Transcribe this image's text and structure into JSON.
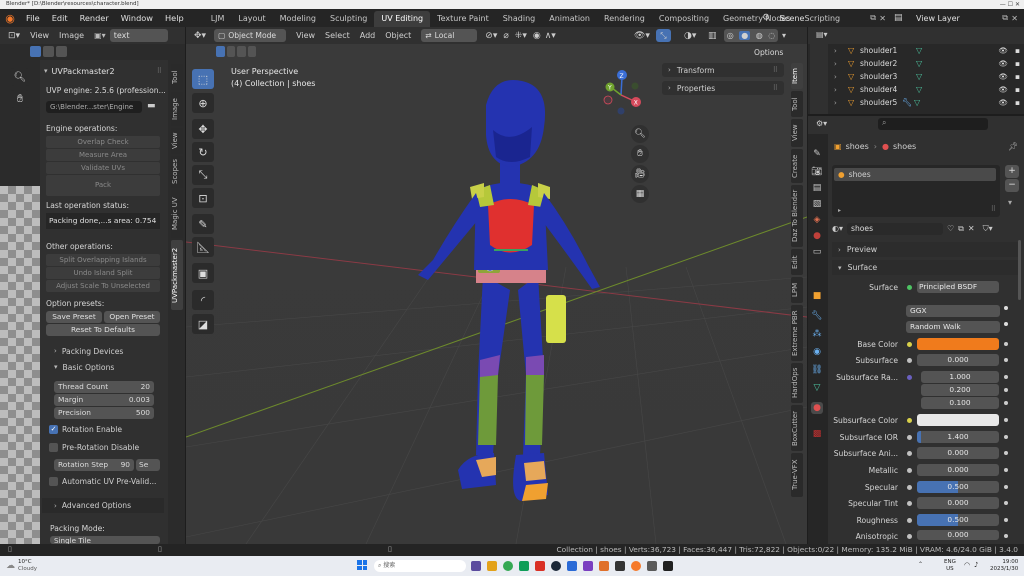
{
  "window": {
    "title": "Blender* [D:\\Blender\\resources\\character.blend]",
    "controls": "—  ☐  ✕"
  },
  "menubar": {
    "menus": [
      "File",
      "Edit",
      "Render",
      "Window",
      "Help"
    ],
    "workspaces": [
      "LJM",
      "Layout",
      "Modeling",
      "Sculpting",
      "UV Editing",
      "Texture Paint",
      "Shading",
      "Animation",
      "Rendering",
      "Compositing",
      "Geometry Nodes",
      "Scripting"
    ],
    "active_workspace": "UV Editing",
    "scene": "Scene",
    "view_layer": "View Layer"
  },
  "uv_editor": {
    "header": {
      "view": "View",
      "image": "Image",
      "image_name": "text"
    },
    "side_tabs": [
      "Tool",
      "Image",
      "View",
      "Scopes",
      "Magic UV",
      "UVPackmaster2"
    ],
    "uvp": {
      "title": "UVPackmaster2",
      "engine": "UVP engine: 2.5.6 (profession...",
      "path": "G:\\Blender...ster\\Engine",
      "engine_ops_label": "Engine operations:",
      "engine_ops": [
        "Overlap Check",
        "Measure Area",
        "Validate UVs",
        "Pack"
      ],
      "last_status_label": "Last operation status:",
      "last_status": "Packing done,...s area: 0.754",
      "other_ops_label": "Other operations:",
      "other_ops": [
        "Split Overlapping Islands",
        "Undo Island Split",
        "Adjust Scale To Unselected"
      ],
      "presets_label": "Option presets:",
      "save_preset": "Save Preset",
      "open_preset": "Open Preset",
      "reset_defaults": "Reset To Defaults",
      "packing_devices": "Packing Devices",
      "basic_options": "Basic Options",
      "thread_count_label": "Thread Count",
      "thread_count": "20",
      "margin_label": "Margin",
      "margin": "0.003",
      "precision_label": "Precision",
      "precision": "500",
      "rotation_enable": "Rotation Enable",
      "pre_rotation": "Pre-Rotation Disable",
      "rotation_step_label": "Rotation Step",
      "rotation_step": "90",
      "rotation_step_unit": "Se",
      "auto_uv": "Automatic UV Pre-Valid...",
      "advanced_options": "Advanced Options",
      "packing_mode_label": "Packing Mode:",
      "packing_mode": "Single Tile"
    }
  },
  "viewport": {
    "mode": "Object Mode",
    "menus": [
      "View",
      "Select",
      "Add",
      "Object"
    ],
    "transform_orientation": "Local",
    "options": "Options",
    "perspective": "User Perspective",
    "collection": "(4) Collection | shoes",
    "n_panel": {
      "transform": "Transform",
      "properties": "Properties"
    },
    "side_tabs": [
      "Item",
      "Tool",
      "View",
      "Create",
      "Daz To Blender",
      "Edit",
      "LPM",
      "Extreme PBR",
      "HardOps",
      "BoxCutter",
      "True-VFX"
    ],
    "gizmo": {
      "x": "X",
      "y": "Y",
      "z": "Z"
    }
  },
  "outliner": {
    "rows": [
      "shoulder1",
      "shoulder2",
      "shoulder3",
      "shoulder4",
      "shoulder5"
    ]
  },
  "properties": {
    "breadcrumb_obj": "shoes",
    "breadcrumb_mat": "shoes",
    "material_slot": "shoes",
    "material_name": "shoes",
    "preview": "Preview",
    "surface_section": "Surface",
    "surface_label": "Surface",
    "surface_value": "Principled BSDF",
    "distribution": "GGX",
    "subsurface_method": "Random Walk",
    "fields": [
      {
        "label": "Base Color",
        "type": "color",
        "color": "#f07b1c"
      },
      {
        "label": "Subsurface",
        "value": "0.000"
      },
      {
        "label": "Subsurface Ra...",
        "values": [
          "1.000",
          "0.200",
          "0.100"
        ]
      },
      {
        "label": "Subsurface Color",
        "type": "color",
        "color": "#e8e8e8"
      },
      {
        "label": "Subsurface IOR",
        "value": "1.400",
        "fill": 0.05
      },
      {
        "label": "Subsurface Ani...",
        "value": "0.000"
      },
      {
        "label": "Metallic",
        "value": "0.000"
      },
      {
        "label": "Specular",
        "value": "0.500",
        "fill": 0.5
      },
      {
        "label": "Specular Tint",
        "value": "0.000"
      },
      {
        "label": "Roughness",
        "value": "0.500",
        "fill": 0.5
      },
      {
        "label": "Anisotropic",
        "value": "0.000"
      }
    ]
  },
  "statusbar": {
    "text": "Collection | shoes | Verts:36,723 | Faces:36,447 | Tris:72,822 | Objects:0/22 | Memory: 135.2 MiB | VRAM: 4.6/24.0 GiB | 3.4.0"
  },
  "taskbar": {
    "weather_temp": "10°C",
    "weather_desc": "Cloudy",
    "search": "搜索",
    "lang": "ENG",
    "lang2": "US",
    "time": "19:00",
    "date": "2023/1/30"
  },
  "colors": {
    "accent": "#4772b3",
    "base_color": "#f07b1c",
    "bg": "#1d1d1d",
    "panel": "#303030"
  }
}
